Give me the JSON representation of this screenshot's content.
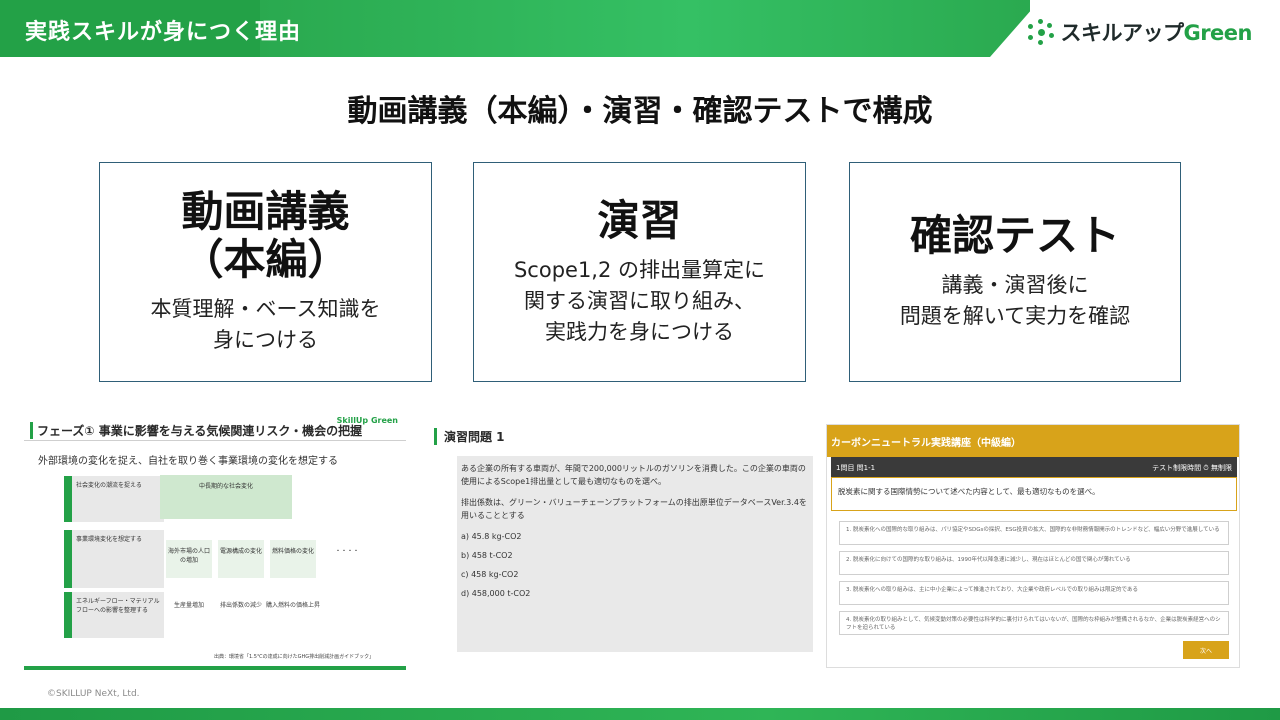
{
  "header": {
    "title": "実践スキルが身につく理由"
  },
  "logo": {
    "prefix": "スキルアップ",
    "suffix": "Green"
  },
  "subtitle": "動画講義（本編）・演習・確認テストで構成",
  "cards": [
    {
      "heading": "動画講義\n（本編）",
      "description": "本質理解・ベース知識を\n身につける"
    },
    {
      "heading": "演習",
      "description": "Scope1,2 の排出量算定に\n関する演習に取り組み、\n実践力を身につける"
    },
    {
      "heading": "確認テスト",
      "description": "講義・演習後に\n問題を解いて実力を確認"
    }
  ],
  "thumb1": {
    "title": "フェーズ① 事業に影響を与える気候関連リスク・機会の把握",
    "logo": "SkillUp Green",
    "subtitle": "外部環境の変化を捉え、自社を取り巻く事業環境の変化を想定する",
    "phases": [
      "社会変化の潮流を捉える",
      "事業環境変化を想定する",
      "エネルギーフロー・マテリアルフローへの影響を整理する"
    ],
    "center": "中長期的な社会変化",
    "boxes": [
      "海外市場の人口の増加",
      "電源構成の変化",
      "燃料価格の変化",
      "・・・・"
    ],
    "notes": [
      "生産量増加",
      "排出係数の減少",
      "購入燃料の価格上昇"
    ],
    "source": "出典：環境省「1.5℃の達成に向けたGHG排出削減計画ガイドブック」"
  },
  "thumb2": {
    "title": "演習問題 1",
    "paragraph1": "ある企業の所有する車両が、年間で200,000リットルのガソリンを消費した。この企業の車両の使用によるScope1排出量として最も適切なものを選べ。",
    "paragraph2": "排出係数は、グリーン・バリューチェーンプラットフォームの排出原単位データベースVer.3.4を用いることとする",
    "options": [
      "a) 45.8 kg-CO2",
      "b) 458 t-CO2",
      "c) 458 kg-CO2",
      "d) 458,000 t-CO2"
    ]
  },
  "thumb3": {
    "header": "カーボンニュートラル実践講座（中級編）",
    "question_no": "1問目 問1-1",
    "timer": "テスト制限時間 ⏱ 無制限",
    "question": "脱炭素に関する国際情勢について述べた内容として、最も適切なものを選べ。",
    "options": [
      "1. 脱炭素化への国際的な取り組みは、パリ協定やSDGsの採択、ESG投資の拡大、国際的な非財務情報開示のトレンドなど、幅広い分野で進展している",
      "2. 脱炭素化に向けての国際的な取り組みは、1990年代以降急速に減少し、現在はほとんどの国で関心が薄れている",
      "3. 脱炭素化への取り組みは、主に中小企業によって推進されており、大企業や政府レベルでの取り組みは限定的である",
      "4. 脱炭素化の取り組みとして、気候変動対策の必要性は科学的に裏付けられてはいないが、国際的な枠組みが整備されるなか、企業は脱炭素経営へのシフトを迫られている"
    ],
    "next": "次へ"
  },
  "copyright": "©SKILLUP NeXt, Ltd.",
  "colors": {
    "brand_green": "#23a147",
    "card_border": "#2f5f78",
    "test_gold": "#d8a31a"
  }
}
